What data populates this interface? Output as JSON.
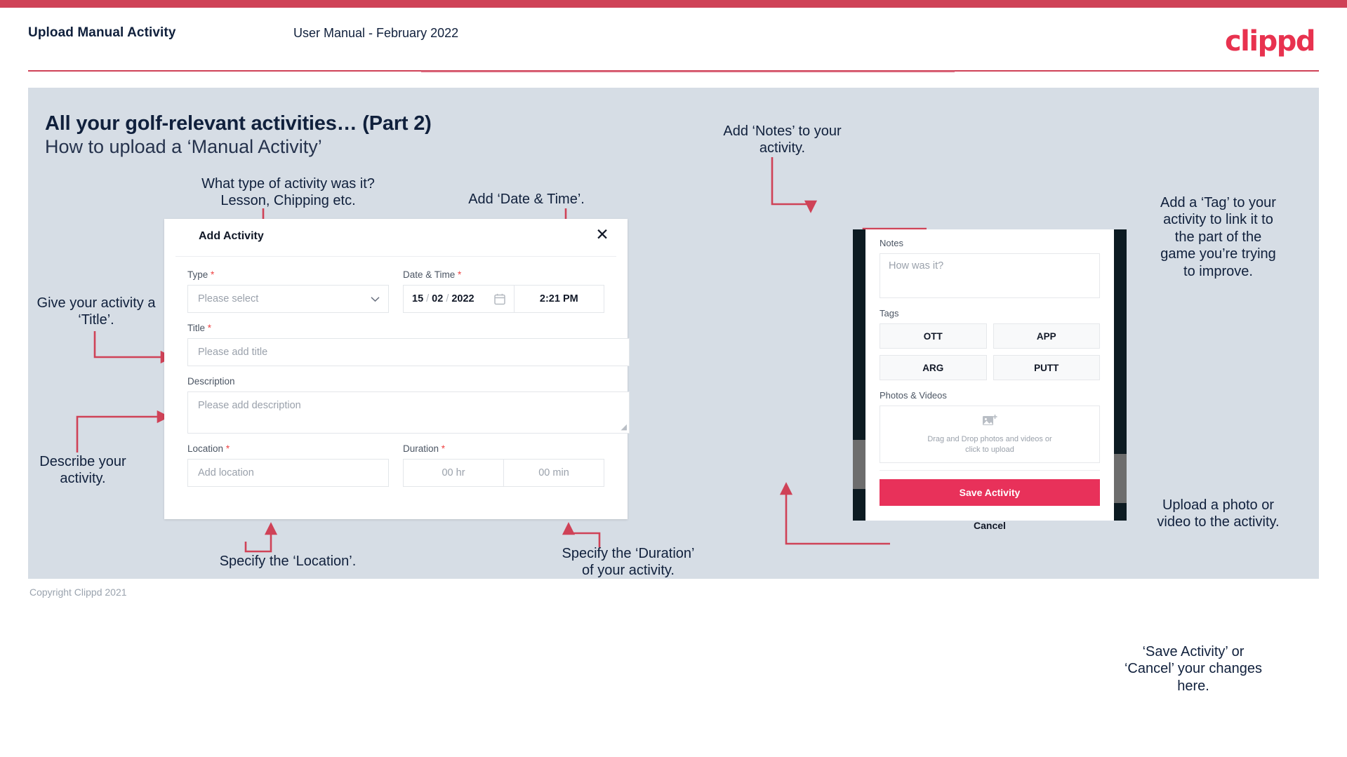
{
  "header": {
    "title": "Upload Manual Activity",
    "subtitle": "User Manual - February 2022",
    "logo": "clippd"
  },
  "slide": {
    "title": "All your golf-relevant activities… (Part 2)",
    "subtitle": "How to upload a ‘Manual Activity’"
  },
  "footer": {
    "copyright": "Copyright Clippd 2021"
  },
  "colors": {
    "brand_red": "#e8324f",
    "accent_bar": "#cf4257",
    "slide_bg": "#d6dde5",
    "text_dark": "#10203c",
    "connector": "#cf4257",
    "save_button": "#e8315a",
    "required_star": "#ef4444"
  },
  "annotations": {
    "type": "What type of activity was it?\nLesson, Chipping etc.",
    "type_line1": "What type of activity was it?",
    "type_line2": "Lesson, Chipping etc.",
    "datetime": "Add ‘Date & Time’.",
    "title": "Give your activity a\n‘Title’.",
    "title_line1": "Give your activity a",
    "title_line2": "‘Title’.",
    "description_line1": "Describe your",
    "description_line2": "activity.",
    "location": "Specify the ‘Location’.",
    "duration_line1": "Specify the ‘Duration’",
    "duration_line2": "of your activity.",
    "notes_line1": "Add ‘Notes’ to your",
    "notes_line2": "activity.",
    "tags_line1": "Add a ‘Tag’ to your",
    "tags_line2": "activity to link it to",
    "tags_line3": "the part of the",
    "tags_line4": "game you’re trying",
    "tags_line5": "to improve.",
    "upload_line1": "Upload a photo or",
    "upload_line2": "video to the activity.",
    "save_line1": "‘Save Activity’ or",
    "save_line2": "‘Cancel’ your changes",
    "save_line3": "here."
  },
  "dialog": {
    "title": "Add Activity",
    "close_icon": "close-icon",
    "fields": {
      "type": {
        "label": "Type",
        "required": "*",
        "placeholder": "Please select",
        "chevron": "chevron-down-icon"
      },
      "datetime": {
        "label": "Date & Time",
        "required": "*",
        "day": "15",
        "month": "02",
        "year": "2022",
        "sep": "/",
        "time": "2:21 PM",
        "calendar_icon": "calendar-icon"
      },
      "title": {
        "label": "Title",
        "required": "*",
        "placeholder": "Please add title"
      },
      "description": {
        "label": "Description",
        "required": "",
        "placeholder": "Please add description"
      },
      "location": {
        "label": "Location",
        "required": "*",
        "placeholder": "Add location"
      },
      "duration": {
        "label": "Duration",
        "required": "*",
        "hours_placeholder": "00 hr",
        "minutes_placeholder": "00 min"
      }
    }
  },
  "phone": {
    "notes": {
      "label": "Notes",
      "placeholder": "How was it?"
    },
    "tags": {
      "label": "Tags",
      "items": [
        "OTT",
        "APP",
        "ARG",
        "PUTT"
      ]
    },
    "photos": {
      "label": "Photos & Videos",
      "icon": "add-image-icon",
      "text_line1": "Drag and Drop photos and videos or",
      "text_line2": "click to upload"
    },
    "save_label": "Save Activity",
    "cancel_label": "Cancel"
  }
}
